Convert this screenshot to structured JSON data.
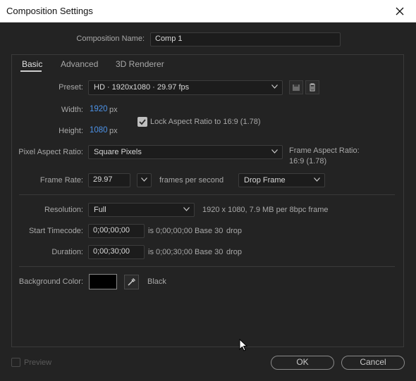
{
  "window": {
    "title": "Composition Settings"
  },
  "comp_name": {
    "label": "Composition Name:",
    "value": "Comp 1"
  },
  "tabs": [
    {
      "label": "Basic",
      "active": true
    },
    {
      "label": "Advanced",
      "active": false
    },
    {
      "label": "3D Renderer",
      "active": false
    }
  ],
  "preset": {
    "label": "Preset:",
    "value": "HD  ·  1920x1080 · 29.97 fps"
  },
  "width": {
    "label": "Width:",
    "value": "1920",
    "unit": "px"
  },
  "height": {
    "label": "Height:",
    "value": "1080",
    "unit": "px"
  },
  "lock_aspect": {
    "label": "Lock Aspect Ratio to 16:9 (1.78)",
    "checked": true
  },
  "pixel_aspect": {
    "label": "Pixel Aspect Ratio:",
    "value": "Square Pixels"
  },
  "frame_aspect": {
    "label": "Frame Aspect Ratio:",
    "value": "16:9 (1.78)"
  },
  "frame_rate": {
    "label": "Frame Rate:",
    "value": "29.97",
    "unit_label": "frames per second",
    "drop_value": "Drop Frame"
  },
  "resolution": {
    "label": "Resolution:",
    "value": "Full",
    "info": "1920 x 1080, 7.9 MB per 8bpc frame"
  },
  "start_timecode": {
    "label": "Start Timecode:",
    "value": "0;00;00;00",
    "is_text": "is 0;00;00;00",
    "base": "Base 30",
    "drop": "drop"
  },
  "duration": {
    "label": "Duration:",
    "value": "0;00;30;00",
    "is_text": "is 0;00;30;00",
    "base": "Base 30",
    "drop": "drop"
  },
  "background_color": {
    "label": "Background Color:",
    "color_name": "Black",
    "swatch": "#000000"
  },
  "footer": {
    "preview_label": "Preview",
    "preview_checked": false,
    "ok_label": "OK",
    "cancel_label": "Cancel"
  },
  "colors": {
    "accent_blue": "#4d93e8",
    "dialog_bg": "#232323",
    "field_bg": "#1c1c1c"
  },
  "icons": [
    "close-icon",
    "chevron-down-icon",
    "save-preset-icon",
    "trash-icon",
    "checkmark-icon",
    "eyedropper-icon",
    "mouse-cursor-icon"
  ]
}
